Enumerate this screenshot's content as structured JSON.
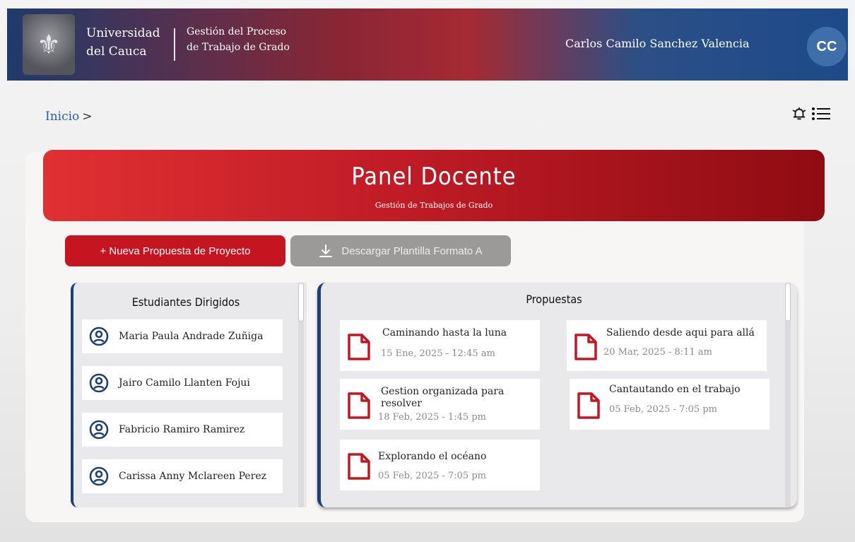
{
  "header": {
    "university": "Universidad\ndel Cauca",
    "app_title": "Gestión del Proceso\nde Trabajo de Grado",
    "user_name": "Carlos Camilo Sanchez Valencia",
    "user_initials": "CC"
  },
  "breadcrumb": {
    "home": "Inicio",
    "separator": ">"
  },
  "banner": {
    "title": "Panel Docente",
    "subtitle": "Gestión de Trabajos de Grado"
  },
  "actions": {
    "new_proposal": "+ Nueva Propuesta de Proyecto",
    "download_template": "Descargar Plantilla Formato A"
  },
  "students": {
    "title": "Estudiantes Dirigidos",
    "items": [
      "Maria Paula Andrade Zuñiga",
      "Jairo Camilo Llanten Fojui",
      "Fabricio Ramiro Ramirez",
      "Carissa Anny Mclareen Perez"
    ]
  },
  "proposals": {
    "title": "Propuestas",
    "items": [
      {
        "title": "Caminando hasta la luna",
        "date": "15 Ene, 2025 - 12:45 am"
      },
      {
        "title": "Saliendo desde aqui para allá",
        "date": "20 Mar, 2025 - 8:11 am"
      },
      {
        "title": "Gestion organizada para resolver",
        "date": "18 Feb, 2025 - 1:45 pm"
      },
      {
        "title": "Cantautando en el trabajo",
        "date": "05 Feb, 2025 - 7:05 pm"
      },
      {
        "title": "Explorando el océano",
        "date": "05 Feb, 2025 - 7:05 pm"
      }
    ]
  },
  "icons": {
    "notification": "bell-icon",
    "menu": "list-icon",
    "document": "document-icon",
    "user": "user-circle-icon"
  },
  "colors": {
    "primary_red": "#c41521",
    "navy": "#1f3f6f",
    "document_red": "#c41521",
    "disabled_gray": "#9c9a99"
  }
}
